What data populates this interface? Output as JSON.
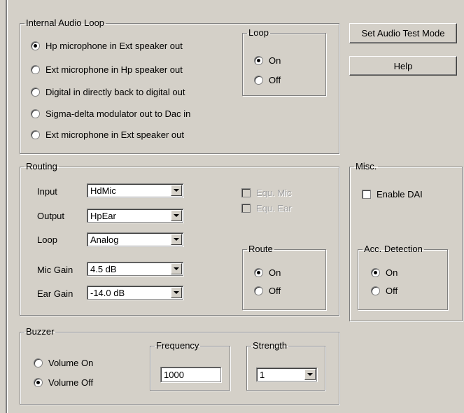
{
  "internal_audio_loop": {
    "title": "Internal Audio Loop",
    "options": [
      {
        "label": "Hp microphone in Ext speaker out",
        "selected": true
      },
      {
        "label": "Ext microphone in Hp speaker out",
        "selected": false
      },
      {
        "label": "Digital in directly back to digital out",
        "selected": false
      },
      {
        "label": "Sigma-delta modulator out to Dac in",
        "selected": false
      },
      {
        "label": "Ext microphone in Ext speaker out",
        "selected": false
      }
    ],
    "loop": {
      "title": "Loop",
      "on_label": "On",
      "off_label": "Off",
      "selected": "On"
    }
  },
  "buttons": {
    "set_test_mode": "Set Audio Test Mode",
    "help": "Help"
  },
  "routing": {
    "title": "Routing",
    "input": {
      "label": "Input",
      "value": "HdMic"
    },
    "output": {
      "label": "Output",
      "value": "HpEar"
    },
    "loop": {
      "label": "Loop",
      "value": "Analog"
    },
    "mic_gain": {
      "label": "Mic Gain",
      "value": "4.5 dB"
    },
    "ear_gain": {
      "label": "Ear Gain",
      "value": "-14.0 dB"
    },
    "equ_mic": {
      "label": "Equ. Mic",
      "checked": false,
      "disabled": true
    },
    "equ_ear": {
      "label": "Equ. Ear",
      "checked": false,
      "disabled": true
    },
    "route": {
      "title": "Route",
      "on_label": "On",
      "off_label": "Off",
      "selected": "On"
    }
  },
  "misc": {
    "title": "Misc.",
    "enable_dai": {
      "label": "Enable DAI",
      "checked": false
    },
    "acc_detection": {
      "title": "Acc. Detection",
      "on_label": "On",
      "off_label": "Off",
      "selected": "On"
    }
  },
  "buzzer": {
    "title": "Buzzer",
    "volume_on": "Volume On",
    "volume_off": "Volume Off",
    "selected": "Volume Off",
    "frequency": {
      "title": "Frequency",
      "value": "1000"
    },
    "strength": {
      "title": "Strength",
      "value": "1"
    }
  }
}
